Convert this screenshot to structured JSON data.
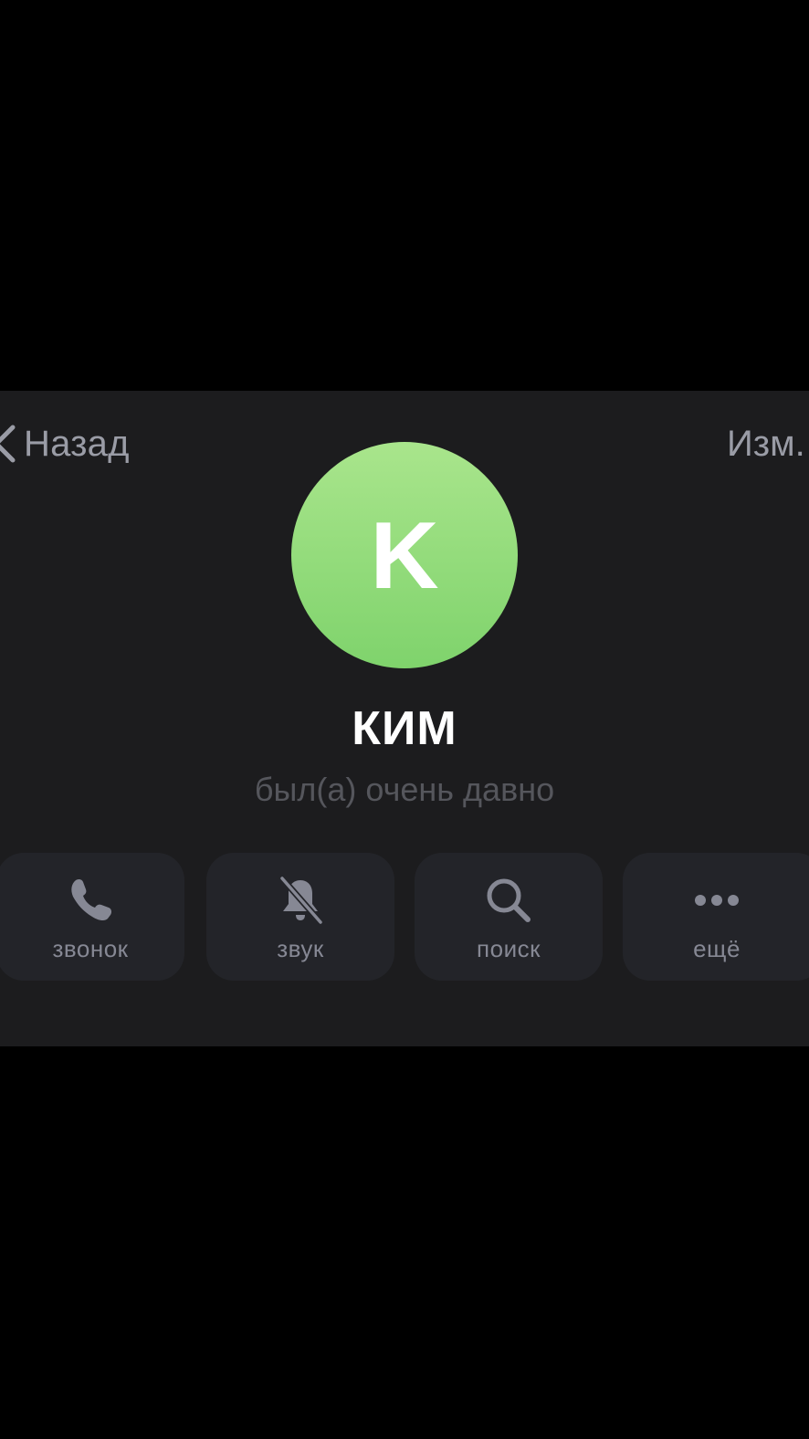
{
  "header": {
    "back_label": "Назад",
    "edit_label": "Изм."
  },
  "profile": {
    "avatar_initial": "K",
    "avatar_color": "#8fdc77",
    "name": "КИМ",
    "status": "был(а) очень давно"
  },
  "actions": [
    {
      "label": "звонок",
      "icon": "phone-icon"
    },
    {
      "label": "звук",
      "icon": "bell-muted-icon"
    },
    {
      "label": "поиск",
      "icon": "search-icon"
    },
    {
      "label": "ещё",
      "icon": "more-dots-icon"
    }
  ],
  "colors": {
    "background": "#000000",
    "panel": "#1c1c1e",
    "button": "#232429",
    "icon": "#868894"
  }
}
